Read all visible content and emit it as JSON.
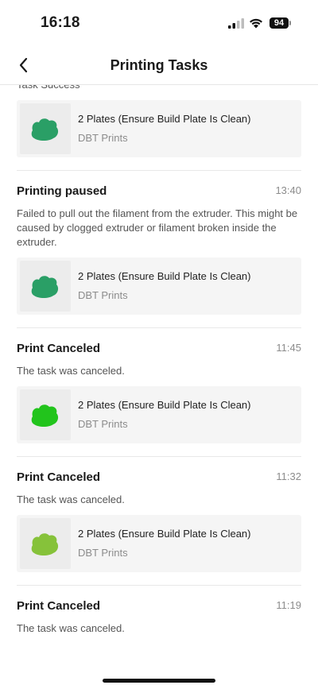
{
  "status": {
    "time": "16:18",
    "battery": "94"
  },
  "nav": {
    "title": "Printing Tasks"
  },
  "tasks": [
    {
      "title": "Task Success",
      "time": "",
      "message": "",
      "card": {
        "name": "2 Plates (Ensure Build Plate Is Clean)",
        "author": "DBT Prints",
        "model_color": "#2a9f66"
      }
    },
    {
      "title": "Printing paused",
      "time": "13:40",
      "message": "Failed to pull out the filament from the extruder. This might be caused by clogged extruder or filament broken inside the extruder.",
      "card": {
        "name": "2 Plates (Ensure Build Plate Is Clean)",
        "author": "DBT Prints",
        "model_color": "#2a9f66"
      }
    },
    {
      "title": "Print Canceled",
      "time": "11:45",
      "message": "The task was canceled.",
      "card": {
        "name": "2 Plates (Ensure Build Plate Is Clean)",
        "author": "DBT Prints",
        "model_color": "#22c41c"
      }
    },
    {
      "title": "Print Canceled",
      "time": "11:32",
      "message": "The task was canceled.",
      "card": {
        "name": "2 Plates (Ensure Build Plate Is Clean)",
        "author": "DBT Prints",
        "model_color": "#86c23a"
      }
    },
    {
      "title": "Print Canceled",
      "time": "11:19",
      "message": "The task was canceled.",
      "card": {
        "name": "",
        "author": "",
        "model_color": ""
      }
    }
  ]
}
